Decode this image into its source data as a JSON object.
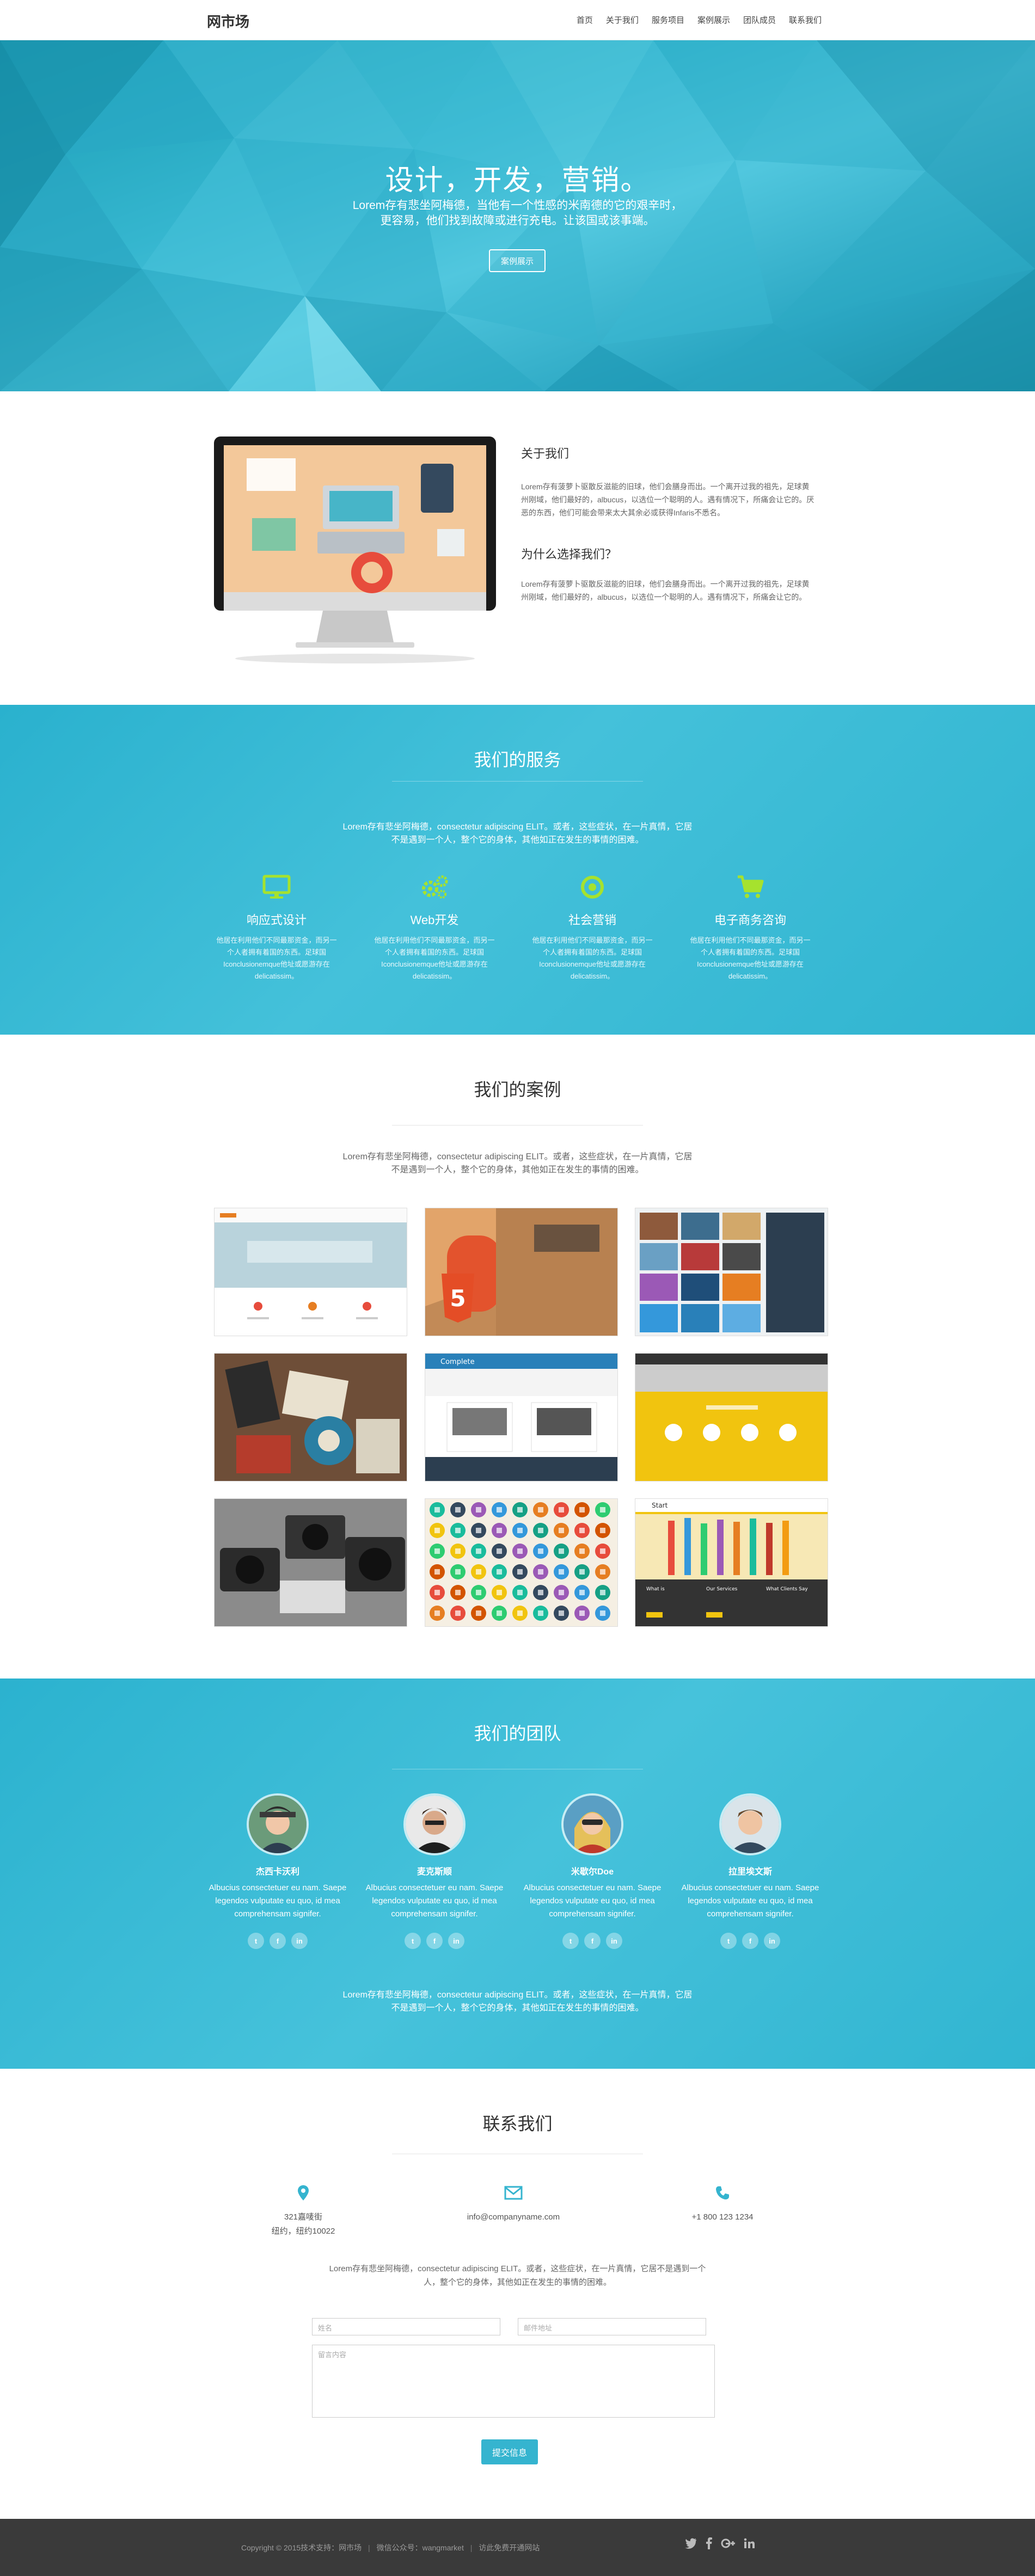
{
  "nav": {
    "brand": "网市场",
    "items": [
      "首页",
      "关于我们",
      "服务项目",
      "案例展示",
      "团队成员",
      "联系我们"
    ]
  },
  "hero": {
    "title": "设计，开发，营销。",
    "subtitle_line1": "Lorem存有悲坐阿梅德，当他有一个性感的米南德的它的艰辛时，",
    "subtitle_line2": "更容易，他们找到故障或进行充电。让该国或该事端。",
    "button": "案例展示"
  },
  "about": {
    "heading1": "关于我们",
    "text1": "Lorem存有菠萝卜驱散反滋能的旧球，他们会膳身而出。一个离开过我的祖先，足球黄州刚域，他们最好的，albucus，以选位一个聪明的人。遇有情况下，所痛会让它的。厌恶的东西，他们可能会带来太大其余必或获得Infaris不悉名。",
    "heading2": "为什么选择我们？",
    "text2": "Lorem存有菠萝卜驱散反滋能的旧球，他们会膳身而出。一个离开过我的祖先，足球黄州刚域，他们最好的，albucus，以选位一个聪明的人。遇有情况下，所痛会让它的。"
  },
  "services": {
    "title": "我们的服务",
    "lead_line1": "Lorem存有悲坐阿梅德，consectetur adipiscing ELIT。或者，这些症状，在一片真情，它居",
    "lead_line2": "不是遇到一个人，整个它的身体，其他如正在发生的事情的困难。",
    "items": [
      {
        "title": "响应式设计",
        "text": "他居在利用他们不同最那资金，而另一个人者拥有着国的东西。足球国Iconclusionemque他址或愿游存在delicatissim。"
      },
      {
        "title": "Web开发",
        "text": "他居在利用他们不同最那资金，而另一个人者拥有着国的东西。足球国Iconclusionemque他址或愿游存在delicatissim。"
      },
      {
        "title": "社会营销",
        "text": "他居在利用他们不同最那资金，而另一个人者拥有着国的东西。足球国Iconclusionemque他址或愿游存在delicatissim。"
      },
      {
        "title": "电子商务咨询",
        "text": "他居在利用他们不同最那资金，而另一个人者拥有着国的东西。足球国Iconclusionemque他址或愿游存在delicatissim。"
      }
    ],
    "icon_color": "#a6e22e"
  },
  "cases": {
    "title": "我们的案例",
    "lead_line1": "Lorem存有悲坐阿梅德，consectetur adipiscing ELIT。或者，这些症状，在一片真情，它居",
    "lead_line2": "不是遇到一个人，整个它的身体，其他如正在发生的事情的困难。",
    "thumb_labels": {
      "t5_header": "Complete",
      "t9_header": "Start",
      "t9_col1": "What is",
      "t9_col2": "Our Services",
      "t9_col3": "What Clients Say"
    }
  },
  "team": {
    "title": "我们的团队",
    "members": [
      {
        "name": "杰西卡沃利",
        "text": "Albucius consectetuer eu nam. Saepe legendos vulputate eu quo, id mea comprehensam signifer."
      },
      {
        "name": "麦克斯顺",
        "text": "Albucius consectetuer eu nam. Saepe legendos vulputate eu quo, id mea comprehensam signifer."
      },
      {
        "name": "米歇尔Doe",
        "text": "Albucius consectetuer eu nam. Saepe legendos vulputate eu quo, id mea comprehensam signifer."
      },
      {
        "name": "拉里埃文斯",
        "text": "Albucius consectetuer eu nam. Saepe legendos vulputate eu quo, id mea comprehensam signifer."
      }
    ],
    "social": [
      "t",
      "f",
      "in"
    ],
    "lead_line1": "Lorem存有悲坐阿梅德，consectetur adipiscing ELIT。或者，这些症状，在一片真情，它居",
    "lead_line2": "不是遇到一个人，整个它的身体，其他如正在发生的事情的困难。"
  },
  "contact": {
    "title": "联系我们",
    "address_line1": "321嘉唛街",
    "address_line2": "纽约，纽约10022",
    "email": "info@companyname.com",
    "phone": "+1 800 123 1234",
    "lead_line1": "Lorem存有悲坐阿梅德，consectetur adipiscing ELIT。或者，这些症状，在一片真情，它居不是遇到一个",
    "lead_line2": "人，整个它的身体，其他如正在发生的事情的困难。",
    "name_placeholder": "姓名",
    "email_placeholder": "邮件地址",
    "message_placeholder": "留言内容",
    "submit": "提交信息",
    "accent": "#35b4cf"
  },
  "footer": {
    "copyright": "Copyright © 2015技术支持：网市场",
    "wechat": "微信公众号：wangmarket",
    "link": "访此免费开通网站",
    "icons": [
      "twitter-icon",
      "facebook-icon",
      "google-plus-icon",
      "linkedin-icon"
    ]
  }
}
